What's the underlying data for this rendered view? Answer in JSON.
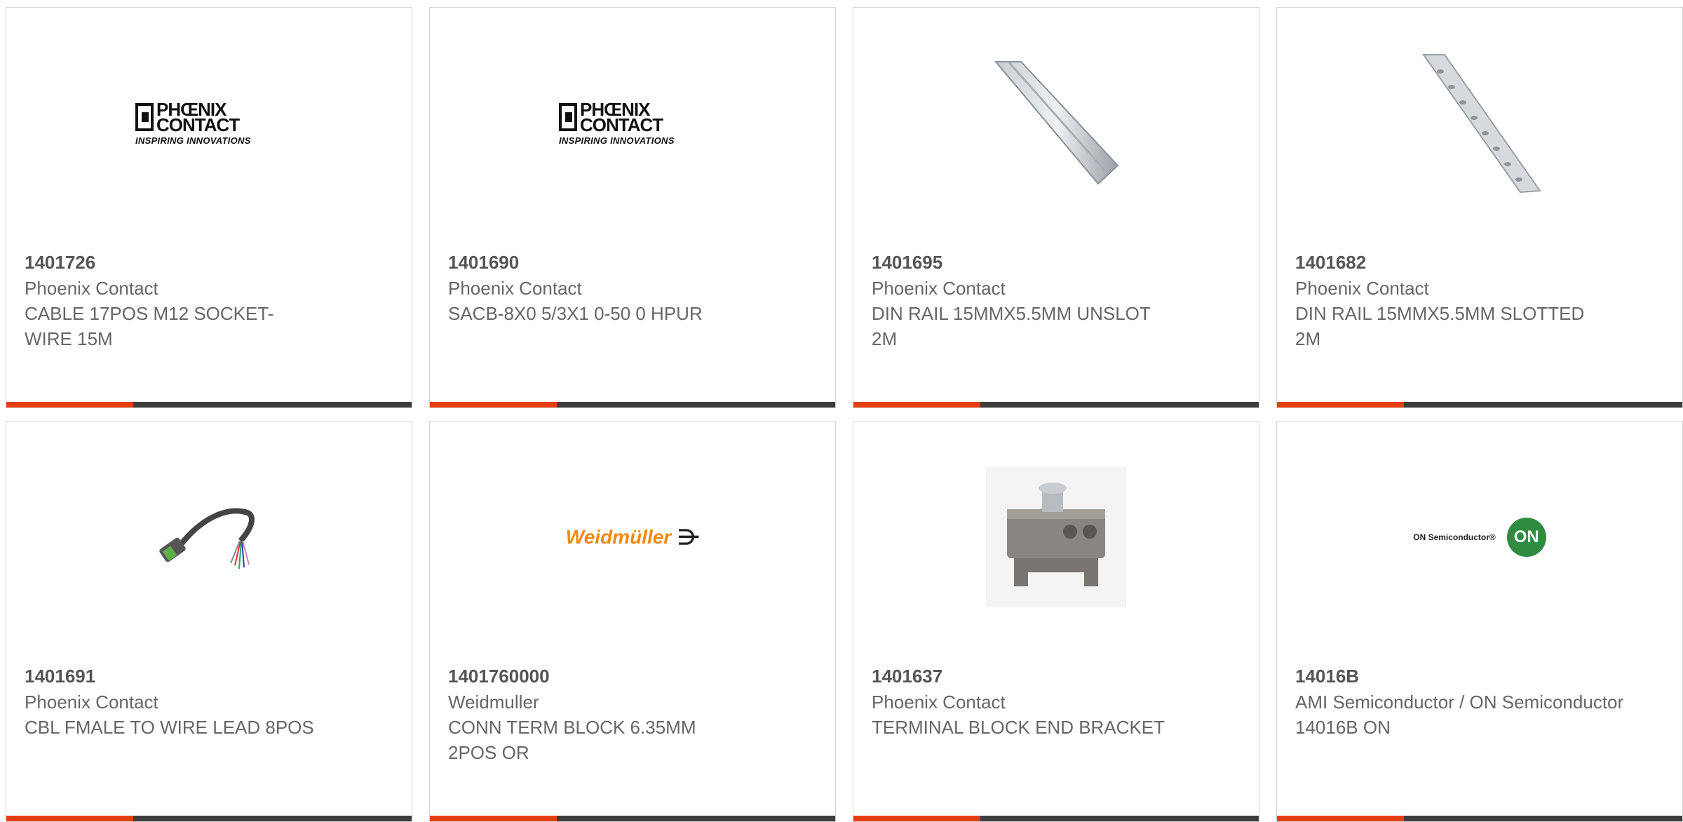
{
  "products": [
    {
      "part_number": "1401726",
      "manufacturer": "Phoenix Contact",
      "description": "CABLE 17POS M12 SOCKET-WIRE 15M",
      "image": "phoenix-contact-logo",
      "logo": {
        "line1": "PHŒNIX",
        "line2": "CONTACT",
        "tagline": "INSPIRING INNOVATIONS"
      }
    },
    {
      "part_number": "1401690",
      "manufacturer": "Phoenix Contact",
      "description": "SACB-8X0 5/3X1 0-50 0 HPUR",
      "image": "phoenix-contact-logo",
      "logo": {
        "line1": "PHŒNIX",
        "line2": "CONTACT",
        "tagline": "INSPIRING INNOVATIONS"
      }
    },
    {
      "part_number": "1401695",
      "manufacturer": "Phoenix Contact",
      "description": "DIN RAIL 15MMX5.5MM UNSLOT 2M",
      "image": "din-rail-unslotted-photo"
    },
    {
      "part_number": "1401682",
      "manufacturer": "Phoenix Contact",
      "description": "DIN RAIL 15MMX5.5MM SLOTTED 2M",
      "image": "din-rail-slotted-photo"
    },
    {
      "part_number": "1401691",
      "manufacturer": "Phoenix Contact",
      "description": "CBL FMALE TO WIRE LEAD 8POS",
      "image": "cable-connector-photo"
    },
    {
      "part_number": "1401760000",
      "manufacturer": "Weidmuller",
      "description": "CONN TERM BLOCK 6.35MM 2POS OR",
      "image": "weidmuller-logo",
      "logo": {
        "text": "Weidmüller",
        "symbol": "⋺"
      }
    },
    {
      "part_number": "1401637",
      "manufacturer": "Phoenix Contact",
      "description": "TERMINAL BLOCK END BRACKET",
      "image": "terminal-block-bracket-photo"
    },
    {
      "part_number": "14016B",
      "manufacturer": "AMI Semiconductor / ON Semiconductor",
      "description": "14016B ON",
      "image": "on-semiconductor-logo",
      "logo": {
        "text": "ON Semiconductor®",
        "badge": "ON"
      }
    }
  ],
  "colors": {
    "accent": "#e53f10",
    "bar": "#3d3d3d",
    "border": "#d4d4d4",
    "text": "#555555"
  }
}
